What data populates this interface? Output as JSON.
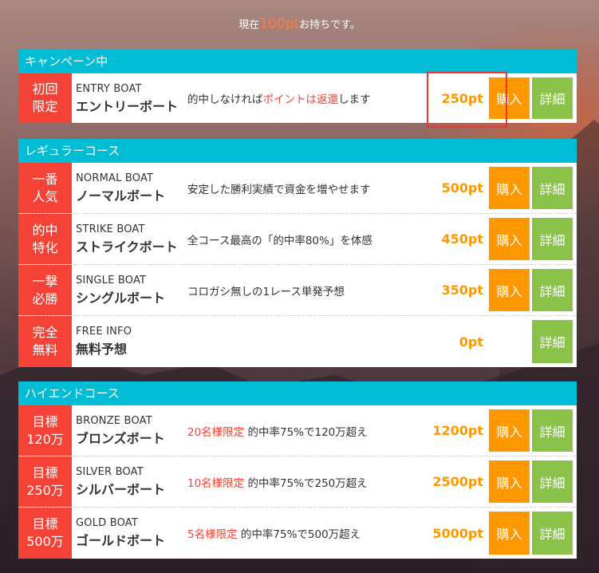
{
  "points": {
    "prefix": "現在",
    "value": "100pt",
    "suffix": "お持ちです。"
  },
  "labels": {
    "buy": "購入",
    "detail": "詳細"
  },
  "campaign": {
    "title": "キャンペーン中",
    "items": [
      {
        "tag": "初回\n限定",
        "en": "ENTRY BOAT",
        "jp": "エントリーボート",
        "desc_before": "的中しなければ",
        "desc_red": "ポイントは返還",
        "desc_after": "します",
        "price": "250pt"
      }
    ]
  },
  "regular": {
    "title": "レギュラーコース",
    "items": [
      {
        "tag": "一番\n人気",
        "en": "NORMAL BOAT",
        "jp": "ノーマルボート",
        "desc": "安定した勝利実績で資金を増やせます",
        "price": "500pt"
      },
      {
        "tag": "的中\n特化",
        "en": "STRIKE BOAT",
        "jp": "ストライクボート",
        "desc": "全コース最高の「的中率80%」を体感",
        "price": "450pt"
      },
      {
        "tag": "一撃\n必勝",
        "en": "SINGLE BOAT",
        "jp": "シングルボート",
        "desc": "コロガシ無しの1レース単発予想",
        "price": "350pt"
      },
      {
        "tag": "完全\n無料",
        "en": "FREE INFO",
        "jp": "無料予想",
        "desc": "",
        "price": "0pt"
      }
    ]
  },
  "highend": {
    "title": "ハイエンドコース",
    "items": [
      {
        "tag": "目標\n120万",
        "en": "BRONZE BOAT",
        "jp": "ブロンズボート",
        "desc_red": "20名様限定",
        "desc_after": " 的中率75%で120万超え",
        "price": "1200pt"
      },
      {
        "tag": "目標\n250万",
        "en": "SILVER BOAT",
        "jp": "シルバーボート",
        "desc_red": "10名様限定",
        "desc_after": " 的中率75%で250万超え",
        "price": "2500pt"
      },
      {
        "tag": "目標\n500万",
        "en": "GOLD BOAT",
        "jp": "ゴールドボート",
        "desc_red": "5名様限定",
        "desc_after": " 的中率75%で500万超え",
        "price": "5000pt"
      }
    ]
  },
  "colors": {
    "header": "#00bcd4",
    "tag": "#f44336",
    "buy": "#ff9800",
    "detail": "#8bc34a",
    "price": "#ff9800"
  }
}
